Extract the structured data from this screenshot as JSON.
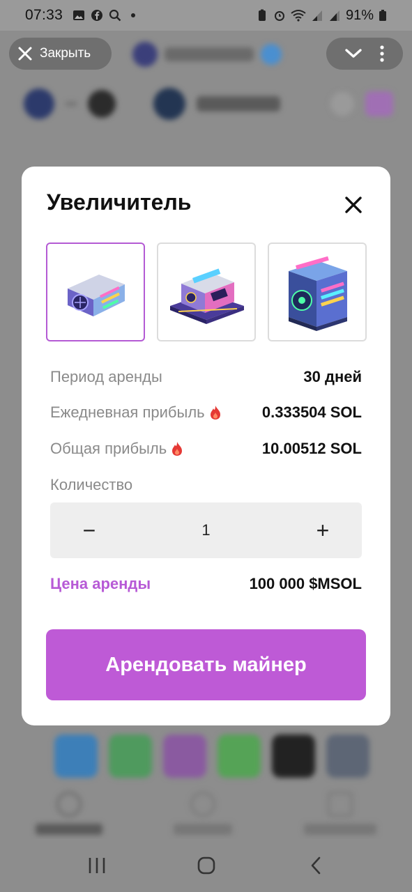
{
  "status_bar": {
    "time": "07:33",
    "battery": "91%",
    "left_icons": [
      "image-icon",
      "facebook-icon",
      "search-icon",
      "dot-icon"
    ],
    "right_icons": [
      "battery-saver-icon",
      "alarm-icon",
      "wifi-icon",
      "signal-icon",
      "signal-icon",
      "battery-icon"
    ]
  },
  "top_bar": {
    "close_label": "Закрыть",
    "menu_icons": [
      "chevron-down-icon",
      "more-vertical-icon"
    ]
  },
  "modal": {
    "title": "Увеличитель",
    "thumbnails": [
      {
        "name": "miner-1",
        "selected": true
      },
      {
        "name": "miner-2",
        "selected": false
      },
      {
        "name": "miner-3",
        "selected": false
      }
    ],
    "rows": [
      {
        "label": "Период аренды",
        "value": "30 дней",
        "fire": false
      },
      {
        "label": "Ежедневная прибыль",
        "value": "0.333504 SOL",
        "fire": true
      },
      {
        "label": "Общая прибыль",
        "value": "10.00512 SOL",
        "fire": true
      }
    ],
    "quantity_label": "Количество",
    "quantity": {
      "minus": "−",
      "value": "1",
      "plus": "+"
    },
    "price_label": "Цена аренды",
    "price_value": "100 000 $MSOL",
    "rent_button": "Арендовать майнер"
  },
  "colors": {
    "accent": "#be5ad6",
    "overlay": "#8f8f8f"
  }
}
